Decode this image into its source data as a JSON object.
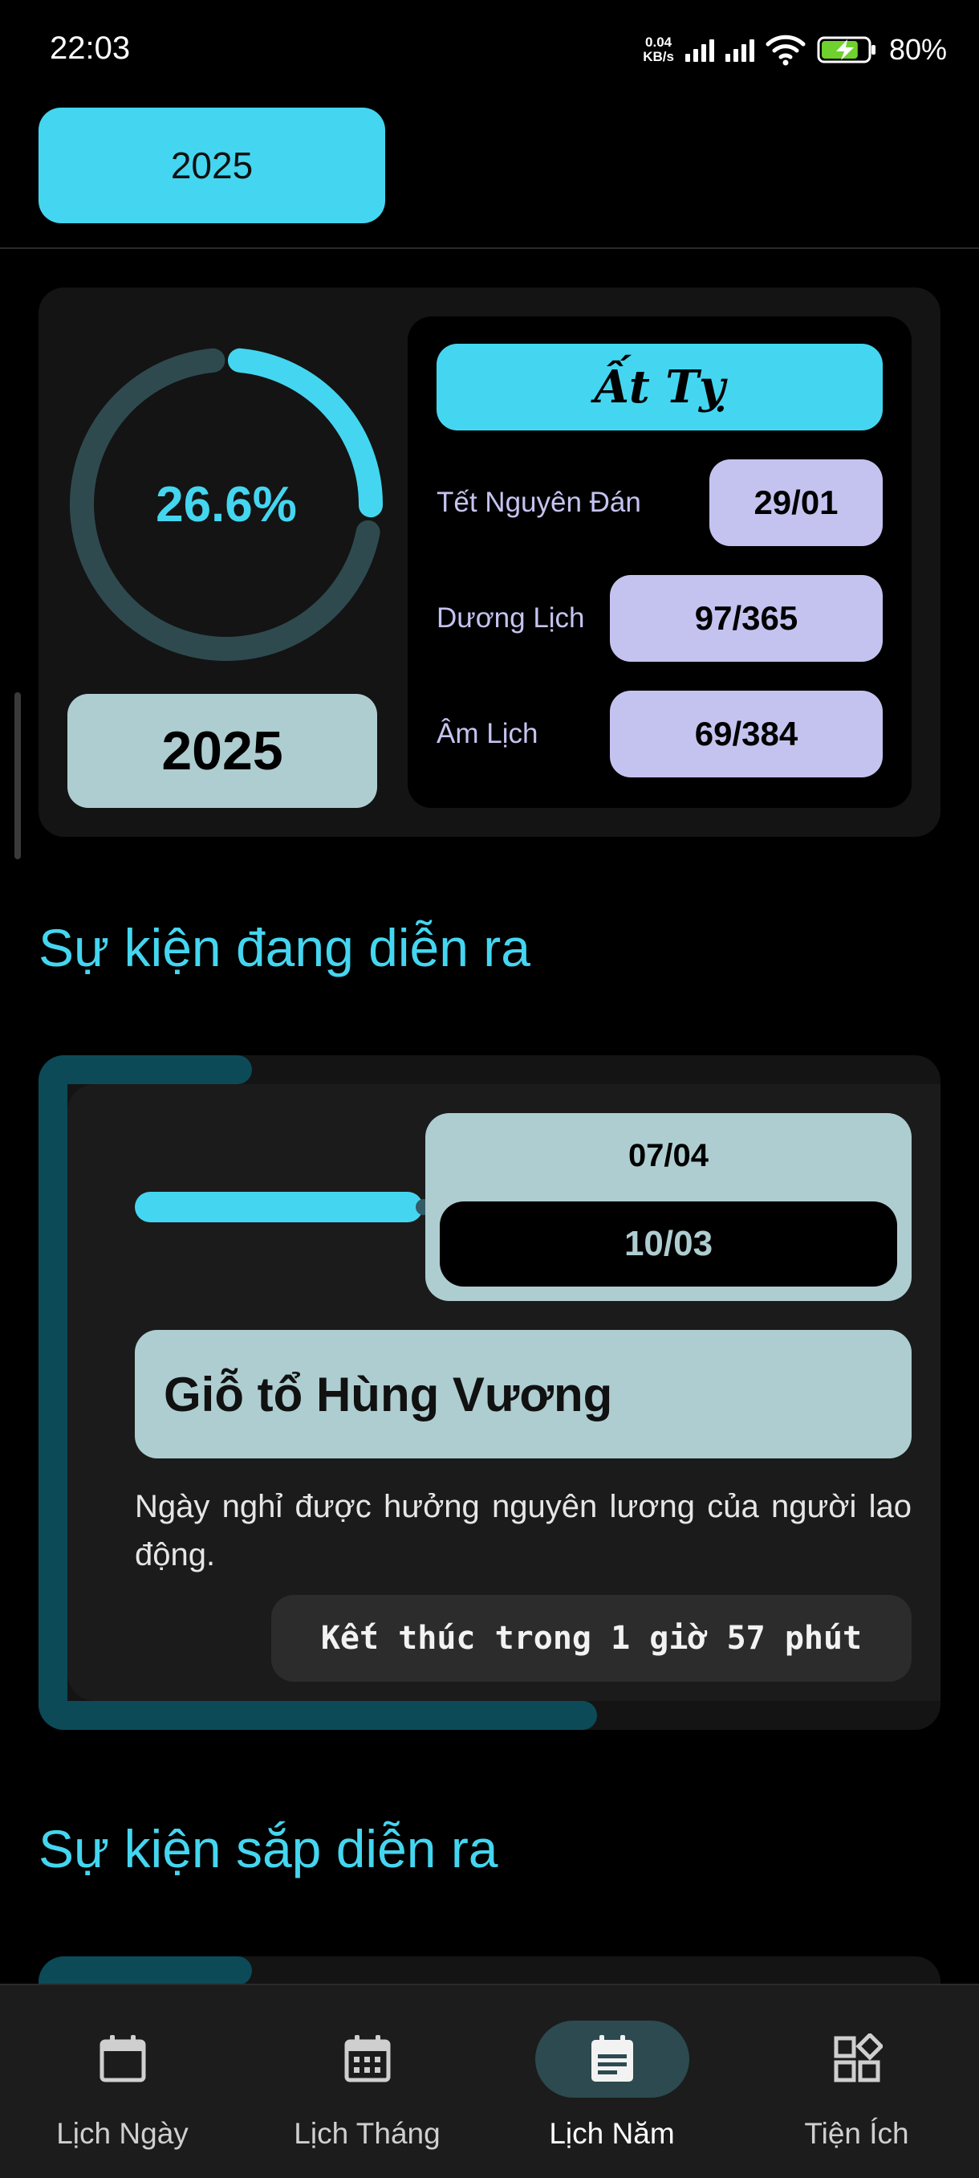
{
  "status_bar": {
    "time": "22:03",
    "net_speed_value": "0.04",
    "net_speed_unit": "KB/s",
    "battery_percent": "80%",
    "battery_level": 0.8,
    "icons": [
      "signal-icon",
      "signal-icon",
      "wifi-icon",
      "battery-charging-icon"
    ]
  },
  "year_selector": {
    "label": "2025"
  },
  "year_summary": {
    "progress_percent_text": "26.6%",
    "progress_fraction": 0.266,
    "year": "2025",
    "can_chi": "Ất Tỵ",
    "rows": [
      {
        "label": "Tết Nguyên Đán",
        "value": "29/01"
      },
      {
        "label": "Dương Lịch",
        "value": "97/365"
      },
      {
        "label": "Âm Lịch",
        "value": "69/384"
      }
    ]
  },
  "current_events": {
    "section_title": "Sự kiện đang diễn ra",
    "event": {
      "solar_date": "07/04",
      "lunar_date": "10/03",
      "progress_fraction": 0.97,
      "title": "Giỗ tổ Hùng Vương",
      "description": "Ngày nghỉ được hưởng nguyên lương của người lao động.",
      "countdown": "Kết thúc trong 1 giờ 57 phút"
    }
  },
  "upcoming_events": {
    "section_title": "Sự kiện sắp diễn ra"
  },
  "bottom_nav": {
    "items": [
      {
        "label": "Lịch Ngày",
        "icon": "calendar-day-icon",
        "active": false
      },
      {
        "label": "Lịch Tháng",
        "icon": "calendar-month-icon",
        "active": false
      },
      {
        "label": "Lịch Năm",
        "icon": "calendar-year-icon",
        "active": true
      },
      {
        "label": "Tiện Ích",
        "icon": "widgets-icon",
        "active": false
      }
    ]
  },
  "colors": {
    "accent": "#44d6f0",
    "lavender": "#c4c3f0",
    "mint": "#aecdd0",
    "event_accent": "#0c4a58",
    "ring_track": "#2f4a4e"
  }
}
